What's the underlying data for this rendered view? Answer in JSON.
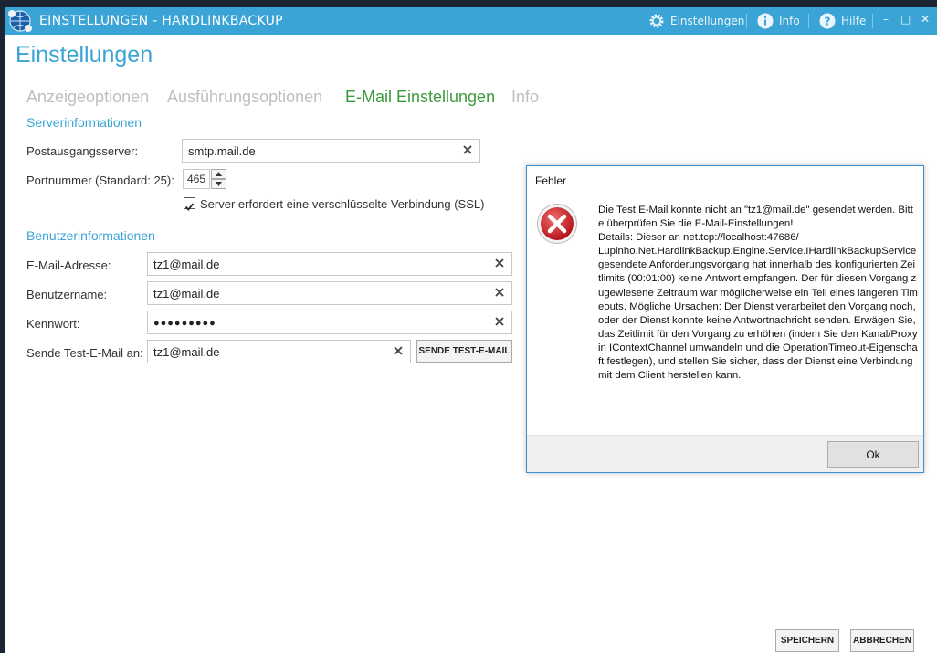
{
  "window": {
    "title": "EINSTELLUNGEN - HARDLINKBACKUP",
    "toolbar": {
      "settings": "Einstellungen",
      "info": "Info",
      "help": "Hilfe"
    },
    "controls": {
      "minimize": "–",
      "maximize": "□",
      "close": "✕"
    }
  },
  "page": {
    "title": "Einstellungen",
    "tabs": [
      {
        "label": "Anzeigeoptionen",
        "active": false
      },
      {
        "label": "Ausführungsoptionen",
        "active": false
      },
      {
        "label": "E-Mail Einstellungen",
        "active": true
      },
      {
        "label": "Info",
        "active": false
      }
    ]
  },
  "server": {
    "section": "Serverinformationen",
    "smtp_label": "Postausgangsserver:",
    "smtp_value": "smtp.mail.de",
    "port_label": "Portnummer (Standard: 25):",
    "port_value": "465",
    "ssl_label": "Server erfordert eine verschlüsselte Verbindung (SSL)",
    "ssl_checked": true
  },
  "user": {
    "section": "Benutzerinformationen",
    "email_label": "E-Mail-Adresse:",
    "email_value": "tz1@mail.de",
    "username_label": "Benutzername:",
    "username_value": "tz1@mail.de",
    "password_label": "Kennwort:",
    "password_value": "●●●●●●●●●",
    "test_label": "Sende Test-E-Mail an:",
    "test_value": "tz1@mail.de",
    "test_button": "SENDE TEST-E-MAIL"
  },
  "footer": {
    "save": "SPEICHERN",
    "cancel": "ABBRECHEN"
  },
  "dialog": {
    "title": "Fehler",
    "message": "Die Test E-Mail konnte nicht an \"tz1@mail.de\" gesendet werden. Bitte überprüfen Sie die E-Mail-Einstellungen!\nDetails: Dieser an net.tcp://localhost:47686/\nLupinho.Net.HardlinkBackup.Engine.Service.IHardlinkBackupService gesendete Anforderungsvorgang hat innerhalb des konfigurierten Zeitlimits (00:01:00) keine Antwort empfangen. Der für diesen Vorgang zugewiesene Zeitraum war möglicherweise ein Teil eines längeren Timeouts. Mögliche Ursachen: Der Dienst verarbeitet den Vorgang noch, oder der Dienst konnte keine Antwortnachricht senden. Erwägen Sie, das Zeitlimit für den Vorgang zu erhöhen (indem Sie den Kanal/Proxy in IContextChannel umwandeln und die OperationTimeout-Eigenschaft festlegen), und stellen Sie sicher, dass der Dienst eine Verbindung mit dem Client herstellen kann.",
    "ok": "Ok"
  },
  "colors": {
    "titlebar": "#3aa4d6",
    "accent": "#3aa4d6",
    "active_tab": "#3c9a3c",
    "inactive_tab": "#bfbfbf",
    "error": "#c8202a"
  },
  "icons": {
    "app": "globe-logo-icon",
    "settings": "gear-icon",
    "info": "info-icon",
    "help": "help-icon",
    "clear": "close-icon",
    "error": "error-icon"
  }
}
